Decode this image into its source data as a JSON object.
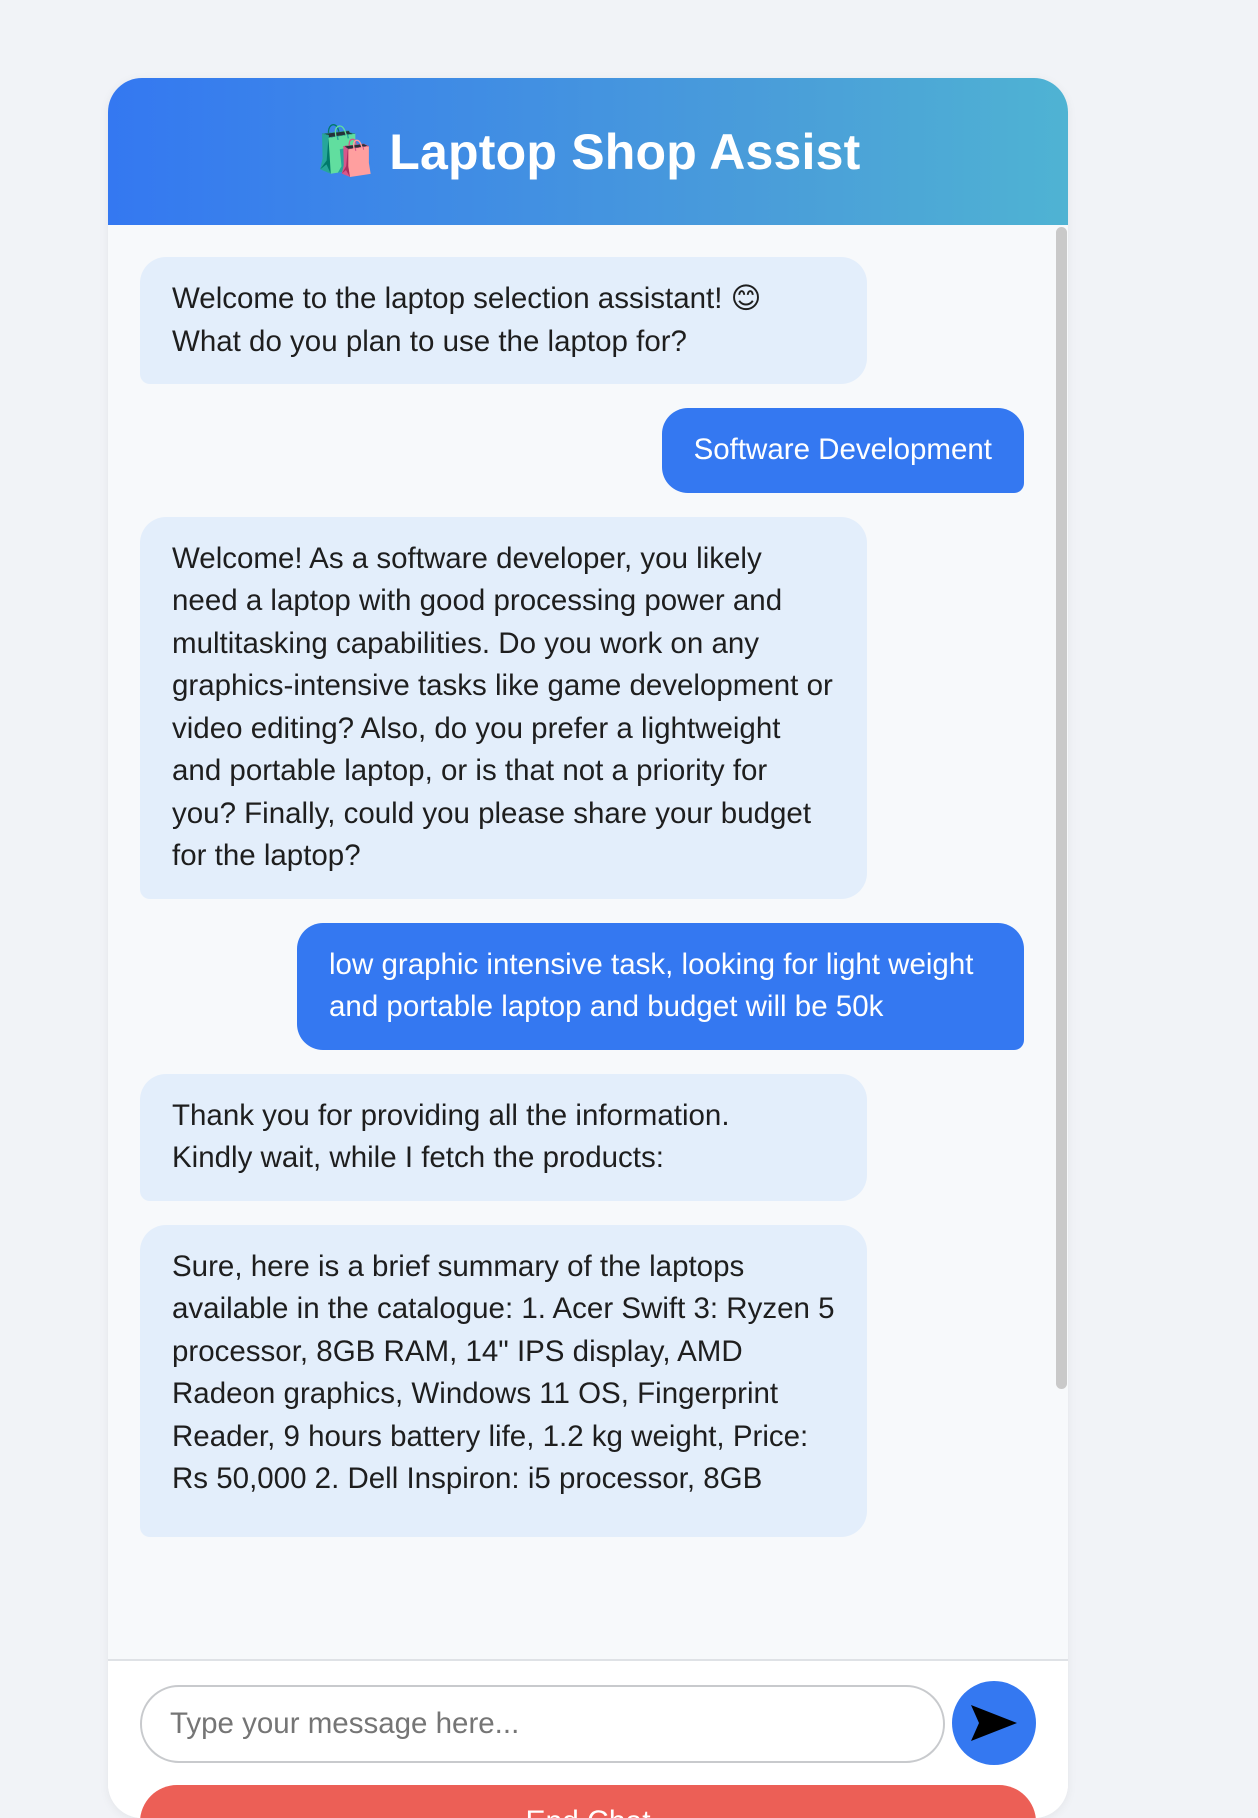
{
  "header": {
    "icon": "shopping-bags-icon",
    "icon_glyph": "🛍️",
    "title": "Laptop Shop Assist"
  },
  "messages": [
    {
      "role": "bot",
      "lines": [
        "Welcome to the laptop selection assistant! 😊",
        "What do you plan to use the laptop for?"
      ]
    },
    {
      "role": "user",
      "text": "Software Development"
    },
    {
      "role": "bot",
      "text": "Welcome! As a software developer, you likely need a laptop with good processing power and multitasking capabilities. Do you work on any graphics-intensive tasks like game development or video editing? Also, do you prefer a lightweight and portable laptop, or is that not a priority for you? Finally, could you please share your budget for the laptop?"
    },
    {
      "role": "user",
      "text": "low graphic intensive task, looking for light weight and portable laptop and budget will be 50k"
    },
    {
      "role": "bot",
      "lines": [
        "Thank you for providing all the information.",
        "Kindly wait, while I fetch the products:"
      ]
    },
    {
      "role": "bot",
      "text": "Sure, here is a brief summary of the laptops available in the catalogue: 1. Acer Swift 3: Ryzen 5 processor, 8GB RAM, 14\" IPS display, AMD Radeon graphics, Windows 11 OS, Fingerprint Reader, 9 hours battery life, 1.2 kg weight, Price: Rs 50,000 2. Dell Inspiron: i5 processor, 8GB"
    }
  ],
  "input": {
    "placeholder": "Type your message here..."
  },
  "send_button": {
    "icon": "send-arrow-icon"
  },
  "end_chat": {
    "label": "End Chat"
  },
  "colors": {
    "accent": "#3478f1",
    "bot_bubble": "#e3eefb",
    "end_chat": "#ec5f56"
  }
}
